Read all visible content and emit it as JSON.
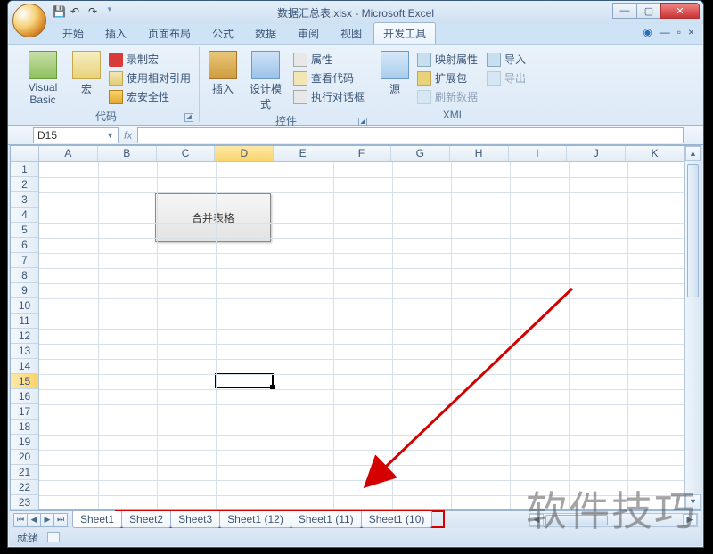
{
  "title": "数据汇总表.xlsx - Microsoft Excel",
  "tabs": [
    "开始",
    "插入",
    "页面布局",
    "公式",
    "数据",
    "审阅",
    "视图",
    "开发工具"
  ],
  "activeTab": 7,
  "ribbon": {
    "g1": {
      "title": "代码",
      "vb": "Visual Basic",
      "macro": "宏",
      "rec": "录制宏",
      "relref": "使用相对引用",
      "sec": "宏安全性"
    },
    "g2": {
      "title": "控件",
      "insert": "插入",
      "design": "设计模式",
      "props": "属性",
      "viewcode": "查看代码",
      "rundlg": "执行对话框"
    },
    "g3": {
      "title": "XML",
      "source": "源",
      "mapprops": "映射属性",
      "expand": "扩展包",
      "refresh": "刷新数据",
      "import": "导入",
      "export": "导出"
    }
  },
  "namebox": "D15",
  "cols": [
    "A",
    "B",
    "C",
    "D",
    "E",
    "F",
    "G",
    "H",
    "I",
    "J",
    "K"
  ],
  "rows": [
    "1",
    "2",
    "3",
    "4",
    "5",
    "6",
    "7",
    "8",
    "9",
    "10",
    "11",
    "12",
    "13",
    "14",
    "15",
    "16",
    "17",
    "18",
    "19",
    "20",
    "21",
    "22",
    "23"
  ],
  "selectedCol": 3,
  "selectedRow": 14,
  "button_label": "合并表格",
  "sheet_tabs": [
    "Sheet1",
    "Sheet2",
    "Sheet3",
    "Sheet1 (12)",
    "Sheet1 (11)",
    "Sheet1 (10)"
  ],
  "active_sheet": 0,
  "status": "就绪",
  "watermark": "软件技巧"
}
